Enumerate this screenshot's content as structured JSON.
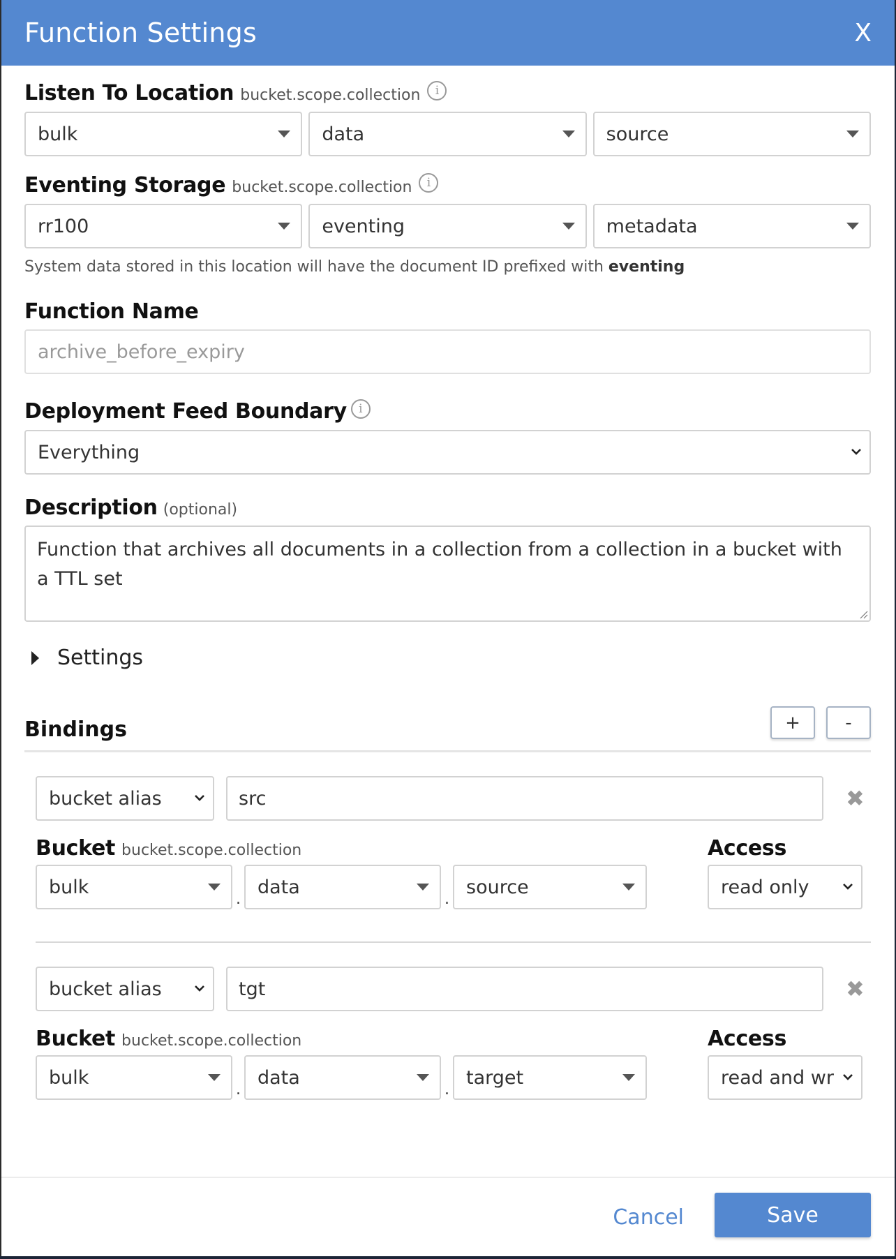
{
  "dialog": {
    "title": "Function Settings",
    "close_label": "X"
  },
  "listen_to": {
    "label": "Listen To Location",
    "sublabel": "bucket.scope.collection",
    "bucket": "bulk",
    "scope": "data",
    "collection": "source"
  },
  "eventing_storage": {
    "label": "Eventing Storage",
    "sublabel": "bucket.scope.collection",
    "bucket": "rr100",
    "scope": "eventing",
    "collection": "metadata",
    "help_text": "System data stored in this location will have the document ID prefixed with ",
    "help_bold": "eventing"
  },
  "function_name": {
    "label": "Function Name",
    "value": "archive_before_expiry"
  },
  "feed_boundary": {
    "label": "Deployment Feed Boundary",
    "value": "Everything"
  },
  "description": {
    "label": "Description",
    "sublabel": "(optional)",
    "value": "Function that archives all documents in a collection from a collection in a bucket with a TTL set"
  },
  "settings": {
    "label": "Settings"
  },
  "bindings": {
    "title": "Bindings",
    "add_label": "+",
    "remove_label": "-",
    "items": [
      {
        "type": "bucket alias",
        "alias": "src",
        "bucket_label": "Bucket",
        "bucket_sublabel": "bucket.scope.collection",
        "bucket": "bulk",
        "scope": "data",
        "collection": "source",
        "access_label": "Access",
        "access": "read only",
        "separator": "."
      },
      {
        "type": "bucket alias",
        "alias": "tgt",
        "bucket_label": "Bucket",
        "bucket_sublabel": "bucket.scope.collection",
        "bucket": "bulk",
        "scope": "data",
        "collection": "target",
        "access_label": "Access",
        "access": "read and wr",
        "separator": "."
      }
    ]
  },
  "footer": {
    "cancel_label": "Cancel",
    "save_label": "Save"
  },
  "icons": {
    "info": "i",
    "remove": "✖"
  },
  "colors": {
    "accent": "#5488d0"
  }
}
